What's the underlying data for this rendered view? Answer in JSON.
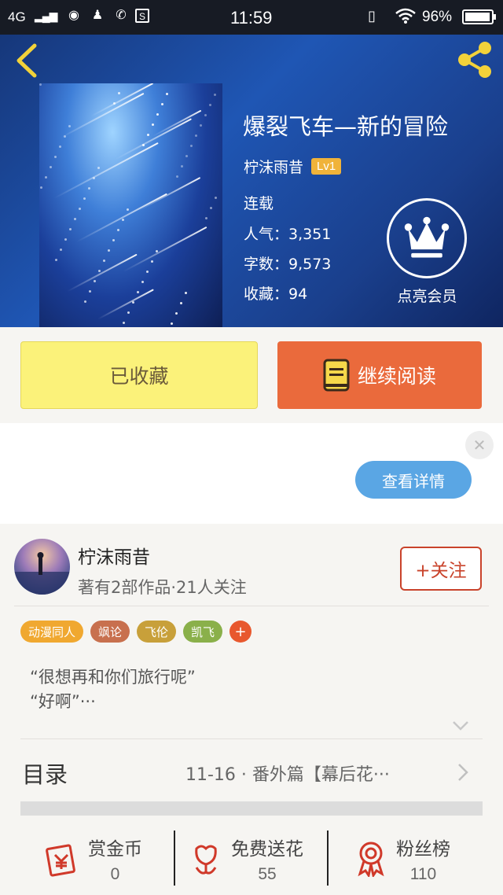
{
  "status_bar": {
    "network": "4G",
    "time": "11:59",
    "battery_percent": "96%",
    "battery_level": 0.96,
    "icons": [
      "signal-icon",
      "browser-icon",
      "qq-icon",
      "missed-call-icon",
      "sim-icon",
      "vibrate-icon",
      "wifi-icon",
      "battery-icon"
    ]
  },
  "book": {
    "title": "爆裂飞车—新的冒险",
    "author": "柠沫雨昔",
    "author_level": "Lv1",
    "status": "连载",
    "popularity": "人气：3,351",
    "word_count": "字数：9,573",
    "favorites": "收藏：94"
  },
  "vip": {
    "label": "点亮会员"
  },
  "actions": {
    "collected_label": "已收藏",
    "continue_label": "继续阅读"
  },
  "ad": {
    "detail_label": "查看详情"
  },
  "author_card": {
    "name": "柠沫雨昔",
    "stats": "著有2部作品·21人关注",
    "follow_label": "+关注",
    "tags": [
      {
        "label": "动漫同人",
        "color": "#f0a830"
      },
      {
        "label": "飒论",
        "color": "#c8704e"
      },
      {
        "label": "飞伦",
        "color": "#c8a03a"
      },
      {
        "label": "凯飞",
        "color": "#8ab04a"
      }
    ],
    "add_tag_label": "+",
    "quote_line1": "“很想再和你们旅行呢”",
    "quote_line2": "“好啊”···"
  },
  "toc": {
    "label": "目录",
    "latest": "11-16 · 番外篇【幕后花···"
  },
  "rewards": [
    {
      "label": "赏金币",
      "value": "0",
      "icon": "gold-coin-icon"
    },
    {
      "label": "免费送花",
      "value": "55",
      "icon": "flower-icon"
    },
    {
      "label": "粉丝榜",
      "value": "110",
      "icon": "medal-icon"
    }
  ],
  "colors": {
    "accent_orange": "#ea6a3c",
    "collected_yellow": "#fbf27a",
    "follow_red": "#c9432b",
    "ad_blue": "#5aa6e4",
    "icon_red": "#d0392a"
  }
}
